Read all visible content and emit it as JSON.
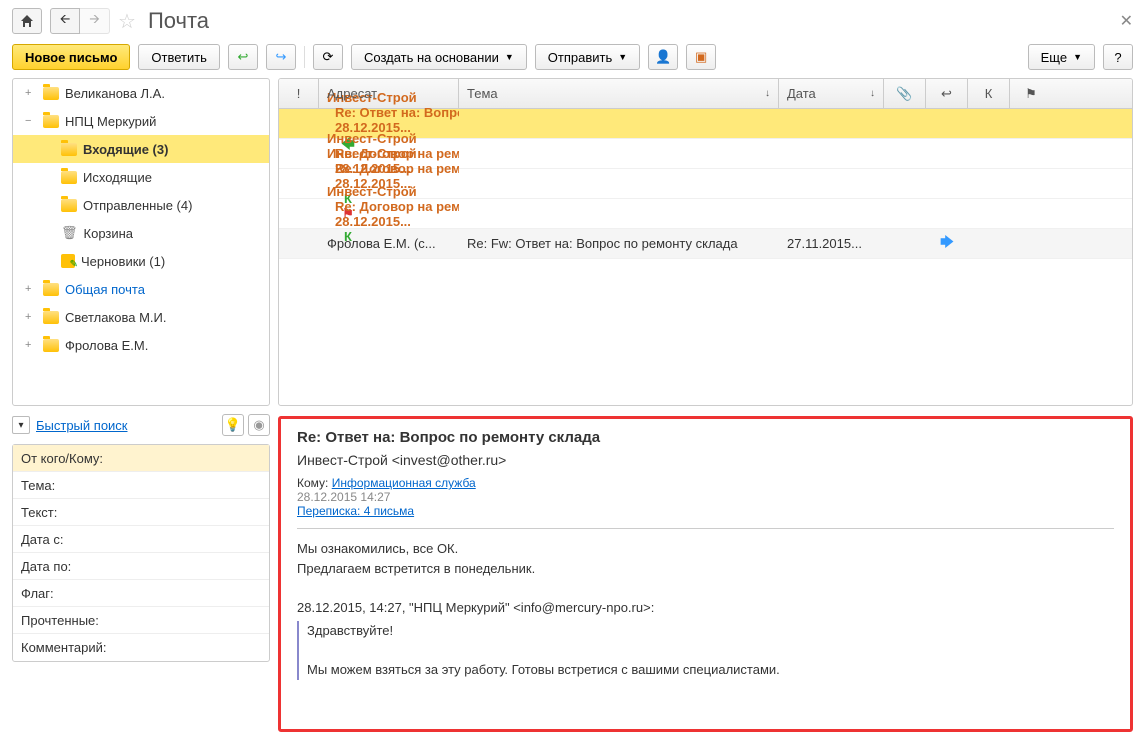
{
  "title": "Почта",
  "toolbar": {
    "new_mail": "Новое письмо",
    "reply": "Ответить",
    "create_based": "Создать на основании",
    "send": "Отправить",
    "more": "Еще"
  },
  "tree": [
    {
      "level": 1,
      "exp": "+",
      "icon": "folder",
      "label": "Великанова Л.А."
    },
    {
      "level": 1,
      "exp": "−",
      "icon": "folder",
      "label": "НПЦ Меркурий"
    },
    {
      "level": 2,
      "icon": "folder",
      "label": "Входящие (3)",
      "selected": true
    },
    {
      "level": 2,
      "icon": "folder",
      "label": "Исходящие"
    },
    {
      "level": 2,
      "icon": "folder",
      "label": "Отправленные (4)"
    },
    {
      "level": 2,
      "icon": "trash",
      "label": "Корзина"
    },
    {
      "level": 2,
      "icon": "draft",
      "label": "Черновики (1)"
    },
    {
      "level": 1,
      "exp": "+",
      "icon": "folder",
      "label": "Общая почта",
      "link": true
    },
    {
      "level": 1,
      "exp": "+",
      "icon": "folder",
      "label": "Светлакова М.И."
    },
    {
      "level": 1,
      "exp": "+",
      "icon": "folder",
      "label": "Фролова Е.М."
    }
  ],
  "quick_search": "Быстрый поиск",
  "filters": [
    {
      "label": "От кого/Кому:",
      "highlight": true
    },
    {
      "label": "Тема:"
    },
    {
      "label": "Текст:"
    },
    {
      "label": "Дата с:"
    },
    {
      "label": "Дата по:"
    },
    {
      "label": "Флаг:"
    },
    {
      "label": "Прочтенные:"
    },
    {
      "label": "Комментарий:"
    }
  ],
  "grid": {
    "headers": {
      "excl": "!",
      "addr": "Адресат",
      "subj": "Тема",
      "date": "Дата",
      "attach": "📎",
      "dir": "↩",
      "k": "К",
      "flag": "⚑"
    },
    "rows": [
      {
        "addr": "Инвест-Строй <in...",
        "subj": "Re: Ответ на: Вопрос по ремонту склада",
        "date": "28.12.2015...",
        "dir": "green",
        "selected": true,
        "bold": false
      },
      {
        "addr": "Инвест-Строй <i...",
        "subj": "Re: Договор на ремонт складского помеще...",
        "date": "28.12.2015...",
        "bold": true
      },
      {
        "addr": "Инвест-Строй <i...",
        "subj": "Re: Договор на ремонт складского помеще...",
        "date": "28.12.2015...",
        "bold": true,
        "k": true,
        "flag": true
      },
      {
        "addr": "Инвест-Строй <i...",
        "subj": "Re: Договор на ремонт складского помеще...",
        "date": "28.12.2015...",
        "bold": true,
        "k": true
      },
      {
        "addr": "Фролова Е.М. (с...",
        "addr_normal": true,
        "subj": "Re: Fw: Ответ на: Вопрос по ремонту склада",
        "date": "27.11.2015...",
        "dir": "blue",
        "hover": true
      }
    ]
  },
  "preview": {
    "subject": "Re: Ответ на: Вопрос по ремонту склада",
    "from": "Инвест-Строй <invest@other.ru>",
    "to_label": "Кому:",
    "to_link": "Информационная служба",
    "datetime": "28.12.2015 14:27",
    "thread_link": "Переписка: 4 письма",
    "body_line1": "Мы ознакомились, все ОК.",
    "body_line2": "Предлагаем встретится в понедельник.",
    "quoted_header": "28.12.2015, 14:27, \"НПЦ Меркурий\" <info@mercury-npo.ru>:",
    "quoted_line1": "Здравствуйте!",
    "quoted_line2": "Мы можем взяться за эту работу. Готовы встретися с вашими специалистами."
  }
}
